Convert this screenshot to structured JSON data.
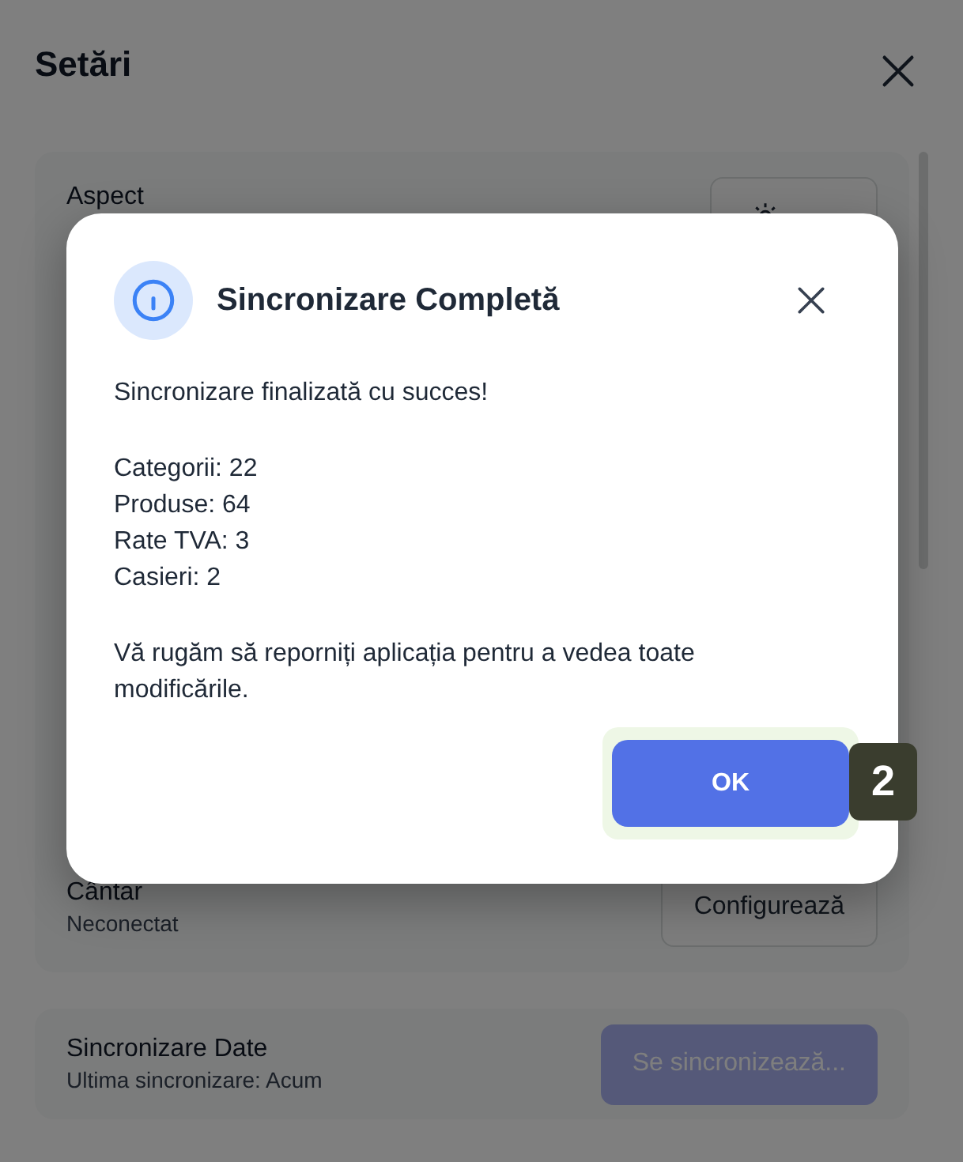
{
  "page": {
    "title": "Setări"
  },
  "sections": [
    {
      "kind": "aspect",
      "label": "Aspect"
    },
    {
      "kind": "device",
      "label": "Cântar",
      "status": "Neconectat",
      "button": {
        "label": "Configurează"
      }
    }
  ],
  "sync": {
    "label": "Sincronizare Date",
    "status": "Ultima sincronizare: Acum",
    "button": {
      "label": "Se sincronizează...",
      "disabled": true
    }
  },
  "dialog": {
    "title": "Sincronizare Completă",
    "message": "Sincronizare finalizată cu succes!",
    "stats": [
      "Categorii: 22",
      "Produse: 64",
      "Rate TVA: 3",
      "Casieri: 2"
    ],
    "note": "Vă rugăm să reporniți aplicația pentru a vedea toate modificările.",
    "ok_button": {
      "label": "OK",
      "focused": true
    },
    "marker": "2"
  }
}
